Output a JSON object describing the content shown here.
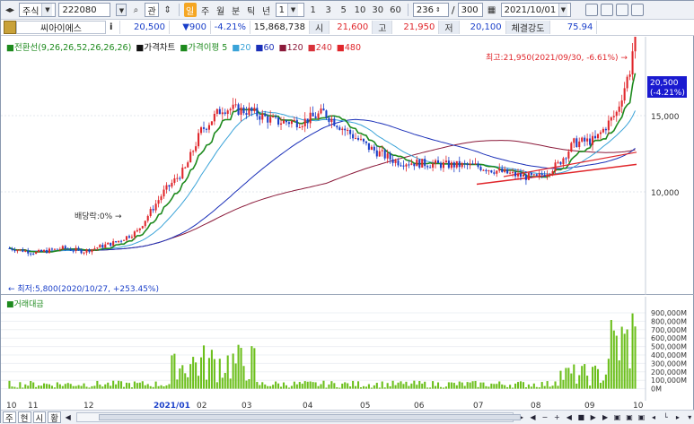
{
  "toolbar": {
    "market_type": "주식",
    "stock_code": "222080",
    "lookup_label": "관",
    "period_buttons": [
      "일",
      "주",
      "월",
      "분",
      "틱",
      "년"
    ],
    "active_period": "일",
    "multiplier": "1",
    "interval_buttons": [
      "1",
      "3",
      "5",
      "10",
      "30",
      "60"
    ],
    "display_count": "236",
    "total_count": "300",
    "date": "2021/10/01"
  },
  "quote": {
    "stock_name": "씨아이에스",
    "info_button": "i",
    "price": "20,500",
    "change": "▼900",
    "change_rate": "-4.21%",
    "volume": "15,868,738",
    "open_label": "시",
    "open": "21,600",
    "high_label": "고",
    "high": "21,950",
    "low_label": "저",
    "low": "20,100",
    "strength_label": "체결강도",
    "strength": "75.94"
  },
  "legend": {
    "items": [
      {
        "text": "전환선(9,26,26,52,26,26,26)",
        "color": "#1d8a1d"
      },
      {
        "text": "가격차트",
        "color": "#111111"
      },
      {
        "text": "가격이평 5",
        "color": "#1d8a1d"
      },
      {
        "text": "20",
        "color": "#3aa3d8"
      },
      {
        "text": "60",
        "color": "#1a2fb8"
      },
      {
        "text": "120",
        "color": "#8b1a3a"
      },
      {
        "text": "240",
        "color": "#d8323a"
      },
      {
        "text": "480",
        "color": "#e0262b"
      }
    ]
  },
  "annotations": {
    "high": "최고:21,950(2021/09/30, -6.61%)",
    "low": "최저:5,800(2020/10/27, +253.45%)",
    "dividend": "배당락:0%",
    "current_price_tag": "20,500",
    "current_rate_tag": "(-4.21%)"
  },
  "price_axis": [
    "15,000",
    "10,000"
  ],
  "volume_panel": {
    "title": "거래대금",
    "axis": [
      "900,000M",
      "800,000M",
      "700,000M",
      "600,000M",
      "500,000M",
      "400,000M",
      "300,000M",
      "200,000M",
      "100,000M",
      "0M"
    ]
  },
  "x_axis": [
    "10",
    "11",
    "12",
    "2021/01",
    "02",
    "03",
    "04",
    "05",
    "06",
    "07",
    "08",
    "09",
    "10"
  ],
  "status_bar": {
    "tabs": [
      "주",
      "현",
      "시",
      "황"
    ]
  },
  "colors": {
    "up": "#e0262b",
    "down": "#1a3fc9",
    "volume": "#6cbf1c",
    "accent": "#f5a623"
  }
}
